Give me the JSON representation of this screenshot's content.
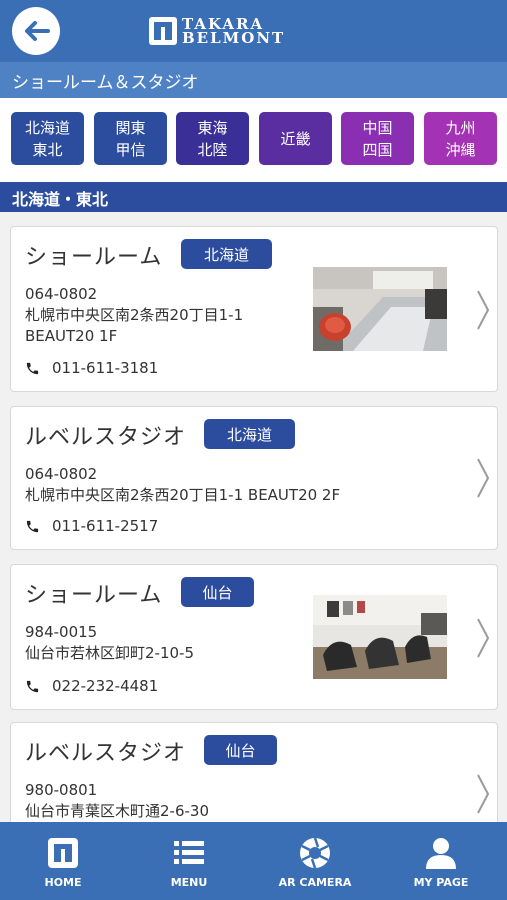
{
  "header": {
    "brand_line1": "TAKARA",
    "brand_line2": "BELMONT",
    "subtitle": "ショールーム＆スタジオ"
  },
  "regions": [
    {
      "line1": "北海道",
      "line2": "東北",
      "color": "#2c4d9e"
    },
    {
      "line1": "関東",
      "line2": "甲信",
      "color": "#2c4d9e"
    },
    {
      "line1": "東海",
      "line2": "北陸",
      "color": "#3a2f96"
    },
    {
      "line1": "近畿",
      "line2": "",
      "color": "#5a2ea0"
    },
    {
      "line1": "中国",
      "line2": "四国",
      "color": "#8a2fb2"
    },
    {
      "line1": "九州",
      "line2": "沖縄",
      "color": "#a432b4"
    }
  ],
  "section_title": "北海道・東北",
  "locations": [
    {
      "title": "ショールーム",
      "badge": "北海道",
      "postal": "064-0802",
      "address_line1": "札幌市中央区南2条西20丁目1-1",
      "address_line2": "BEAUT20 1F",
      "phone": "011-611-3181"
    },
    {
      "title": "ルベルスタジオ",
      "badge": "北海道",
      "postal": "064-0802",
      "address_line1": "札幌市中央区南2条西20丁目1-1 BEAUT20 2F",
      "address_line2": "",
      "phone": "011-611-2517"
    },
    {
      "title": "ショールーム",
      "badge": "仙台",
      "postal": "984-0015",
      "address_line1": "仙台市若林区卸町2-10-5",
      "address_line2": "",
      "phone": "022-232-4481"
    },
    {
      "title": "ルベルスタジオ",
      "badge": "仙台",
      "postal": "980-0801",
      "address_line1": "仙台市青葉区木町通2-6-30",
      "address_line2": "",
      "phone": ""
    }
  ],
  "tabs": [
    {
      "label": "HOME",
      "icon": "home-icon"
    },
    {
      "label": "MENU",
      "icon": "menu-icon"
    },
    {
      "label": "AR CAMERA",
      "icon": "camera-shutter-icon"
    },
    {
      "label": "MY PAGE",
      "icon": "user-icon"
    }
  ],
  "colors": {
    "header": "#3a6fb5",
    "subheader": "#4f82c4",
    "section": "#2c4d9e",
    "badge": "#2c4d9e"
  }
}
